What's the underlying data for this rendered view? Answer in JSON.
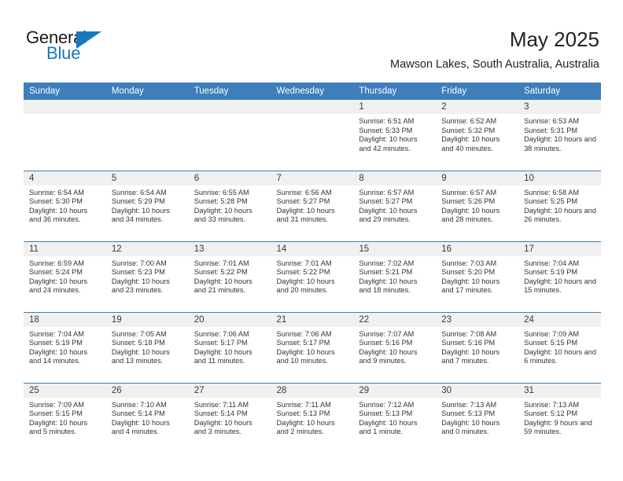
{
  "brand": {
    "name_part1": "General",
    "name_part2": "Blue",
    "triangle_color": "#1878be",
    "blue_color": "#1878be"
  },
  "header": {
    "month_title": "May 2025",
    "location": "Mawson Lakes, South Australia, Australia",
    "header_bg": "#3d7ebb",
    "daynum_bg": "#f0f0f0"
  },
  "weekday_headers": [
    "Sunday",
    "Monday",
    "Tuesday",
    "Wednesday",
    "Thursday",
    "Friday",
    "Saturday"
  ],
  "weeks": [
    [
      {
        "day": "",
        "empty": true
      },
      {
        "day": "",
        "empty": true
      },
      {
        "day": "",
        "empty": true
      },
      {
        "day": "",
        "empty": true
      },
      {
        "day": "1",
        "sunrise": "Sunrise: 6:51 AM",
        "sunset": "Sunset: 5:33 PM",
        "daylight": "Daylight: 10 hours and 42 minutes."
      },
      {
        "day": "2",
        "sunrise": "Sunrise: 6:52 AM",
        "sunset": "Sunset: 5:32 PM",
        "daylight": "Daylight: 10 hours and 40 minutes."
      },
      {
        "day": "3",
        "sunrise": "Sunrise: 6:53 AM",
        "sunset": "Sunset: 5:31 PM",
        "daylight": "Daylight: 10 hours and 38 minutes."
      }
    ],
    [
      {
        "day": "4",
        "sunrise": "Sunrise: 6:54 AM",
        "sunset": "Sunset: 5:30 PM",
        "daylight": "Daylight: 10 hours and 36 minutes."
      },
      {
        "day": "5",
        "sunrise": "Sunrise: 6:54 AM",
        "sunset": "Sunset: 5:29 PM",
        "daylight": "Daylight: 10 hours and 34 minutes."
      },
      {
        "day": "6",
        "sunrise": "Sunrise: 6:55 AM",
        "sunset": "Sunset: 5:28 PM",
        "daylight": "Daylight: 10 hours and 33 minutes."
      },
      {
        "day": "7",
        "sunrise": "Sunrise: 6:56 AM",
        "sunset": "Sunset: 5:27 PM",
        "daylight": "Daylight: 10 hours and 31 minutes."
      },
      {
        "day": "8",
        "sunrise": "Sunrise: 6:57 AM",
        "sunset": "Sunset: 5:27 PM",
        "daylight": "Daylight: 10 hours and 29 minutes."
      },
      {
        "day": "9",
        "sunrise": "Sunrise: 6:57 AM",
        "sunset": "Sunset: 5:26 PM",
        "daylight": "Daylight: 10 hours and 28 minutes."
      },
      {
        "day": "10",
        "sunrise": "Sunrise: 6:58 AM",
        "sunset": "Sunset: 5:25 PM",
        "daylight": "Daylight: 10 hours and 26 minutes."
      }
    ],
    [
      {
        "day": "11",
        "sunrise": "Sunrise: 6:59 AM",
        "sunset": "Sunset: 5:24 PM",
        "daylight": "Daylight: 10 hours and 24 minutes."
      },
      {
        "day": "12",
        "sunrise": "Sunrise: 7:00 AM",
        "sunset": "Sunset: 5:23 PM",
        "daylight": "Daylight: 10 hours and 23 minutes."
      },
      {
        "day": "13",
        "sunrise": "Sunrise: 7:01 AM",
        "sunset": "Sunset: 5:22 PM",
        "daylight": "Daylight: 10 hours and 21 minutes."
      },
      {
        "day": "14",
        "sunrise": "Sunrise: 7:01 AM",
        "sunset": "Sunset: 5:22 PM",
        "daylight": "Daylight: 10 hours and 20 minutes."
      },
      {
        "day": "15",
        "sunrise": "Sunrise: 7:02 AM",
        "sunset": "Sunset: 5:21 PM",
        "daylight": "Daylight: 10 hours and 18 minutes."
      },
      {
        "day": "16",
        "sunrise": "Sunrise: 7:03 AM",
        "sunset": "Sunset: 5:20 PM",
        "daylight": "Daylight: 10 hours and 17 minutes."
      },
      {
        "day": "17",
        "sunrise": "Sunrise: 7:04 AM",
        "sunset": "Sunset: 5:19 PM",
        "daylight": "Daylight: 10 hours and 15 minutes."
      }
    ],
    [
      {
        "day": "18",
        "sunrise": "Sunrise: 7:04 AM",
        "sunset": "Sunset: 5:19 PM",
        "daylight": "Daylight: 10 hours and 14 minutes."
      },
      {
        "day": "19",
        "sunrise": "Sunrise: 7:05 AM",
        "sunset": "Sunset: 5:18 PM",
        "daylight": "Daylight: 10 hours and 13 minutes."
      },
      {
        "day": "20",
        "sunrise": "Sunrise: 7:06 AM",
        "sunset": "Sunset: 5:17 PM",
        "daylight": "Daylight: 10 hours and 11 minutes."
      },
      {
        "day": "21",
        "sunrise": "Sunrise: 7:06 AM",
        "sunset": "Sunset: 5:17 PM",
        "daylight": "Daylight: 10 hours and 10 minutes."
      },
      {
        "day": "22",
        "sunrise": "Sunrise: 7:07 AM",
        "sunset": "Sunset: 5:16 PM",
        "daylight": "Daylight: 10 hours and 9 minutes."
      },
      {
        "day": "23",
        "sunrise": "Sunrise: 7:08 AM",
        "sunset": "Sunset: 5:16 PM",
        "daylight": "Daylight: 10 hours and 7 minutes."
      },
      {
        "day": "24",
        "sunrise": "Sunrise: 7:09 AM",
        "sunset": "Sunset: 5:15 PM",
        "daylight": "Daylight: 10 hours and 6 minutes."
      }
    ],
    [
      {
        "day": "25",
        "sunrise": "Sunrise: 7:09 AM",
        "sunset": "Sunset: 5:15 PM",
        "daylight": "Daylight: 10 hours and 5 minutes."
      },
      {
        "day": "26",
        "sunrise": "Sunrise: 7:10 AM",
        "sunset": "Sunset: 5:14 PM",
        "daylight": "Daylight: 10 hours and 4 minutes."
      },
      {
        "day": "27",
        "sunrise": "Sunrise: 7:11 AM",
        "sunset": "Sunset: 5:14 PM",
        "daylight": "Daylight: 10 hours and 3 minutes."
      },
      {
        "day": "28",
        "sunrise": "Sunrise: 7:11 AM",
        "sunset": "Sunset: 5:13 PM",
        "daylight": "Daylight: 10 hours and 2 minutes."
      },
      {
        "day": "29",
        "sunrise": "Sunrise: 7:12 AM",
        "sunset": "Sunset: 5:13 PM",
        "daylight": "Daylight: 10 hours and 1 minute."
      },
      {
        "day": "30",
        "sunrise": "Sunrise: 7:13 AM",
        "sunset": "Sunset: 5:13 PM",
        "daylight": "Daylight: 10 hours and 0 minutes."
      },
      {
        "day": "31",
        "sunrise": "Sunrise: 7:13 AM",
        "sunset": "Sunset: 5:12 PM",
        "daylight": "Daylight: 9 hours and 59 minutes."
      }
    ]
  ]
}
